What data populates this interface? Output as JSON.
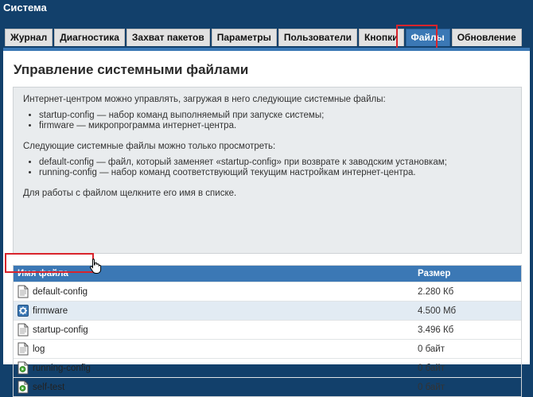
{
  "app": {
    "title": "Система"
  },
  "tabs": [
    {
      "label": "Журнал",
      "active": false
    },
    {
      "label": "Диагностика",
      "active": false
    },
    {
      "label": "Захват пакетов",
      "active": false
    },
    {
      "label": "Параметры",
      "active": false
    },
    {
      "label": "Пользователи",
      "active": false
    },
    {
      "label": "Кнопки",
      "active": false
    },
    {
      "label": "Файлы",
      "active": true
    },
    {
      "label": "Обновление",
      "active": false
    }
  ],
  "page": {
    "title": "Управление системными файлами",
    "intro": "Интернет-центром можно управлять, загружая в него следующие системные файлы:",
    "editable": [
      "startup-config — набор команд выполняемый при запуске системы;",
      "firmware — микропрограмма интернет-центра."
    ],
    "view_intro": "Следующие системные файлы можно только просмотреть:",
    "viewonly": [
      "default-config — файл, который заменяет «startup-config» при возврате к заводским установкам;",
      "running-config — набор команд соответствующий текущим настройкам интернет-центра."
    ],
    "hint": "Для работы с файлом щелкните его имя в списке."
  },
  "table": {
    "col_name": "Имя файла",
    "col_size": "Размер",
    "rows": [
      {
        "name": "default-config",
        "size": "2.280 Кб",
        "icon": "text-file-icon"
      },
      {
        "name": "firmware",
        "size": "4.500 Мб",
        "icon": "firmware-gear-icon"
      },
      {
        "name": "startup-config",
        "size": "3.496 Кб",
        "icon": "text-file-icon"
      },
      {
        "name": "log",
        "size": "0 байт",
        "icon": "text-file-icon"
      },
      {
        "name": "running-config",
        "size": "0 байт",
        "icon": "executable-file-icon"
      },
      {
        "name": "self-test",
        "size": "0 байт",
        "icon": "executable-file-icon"
      }
    ]
  },
  "colors": {
    "header_bg": "#12406b",
    "accent": "#3b78b5",
    "highlight": "#d9242c"
  }
}
